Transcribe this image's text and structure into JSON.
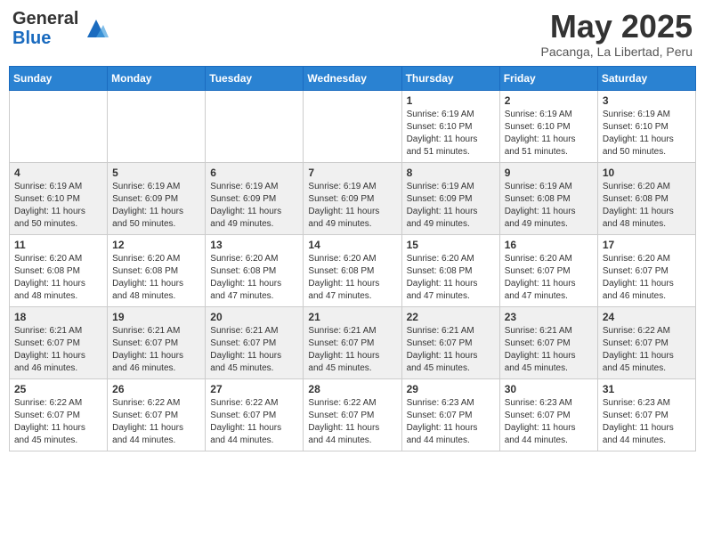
{
  "header": {
    "logo_general": "General",
    "logo_blue": "Blue",
    "month_title": "May 2025",
    "subtitle": "Pacanga, La Libertad, Peru"
  },
  "days_of_week": [
    "Sunday",
    "Monday",
    "Tuesday",
    "Wednesday",
    "Thursday",
    "Friday",
    "Saturday"
  ],
  "weeks": [
    [
      {
        "day": "",
        "info": ""
      },
      {
        "day": "",
        "info": ""
      },
      {
        "day": "",
        "info": ""
      },
      {
        "day": "",
        "info": ""
      },
      {
        "day": "1",
        "info": "Sunrise: 6:19 AM\nSunset: 6:10 PM\nDaylight: 11 hours and 51 minutes."
      },
      {
        "day": "2",
        "info": "Sunrise: 6:19 AM\nSunset: 6:10 PM\nDaylight: 11 hours and 51 minutes."
      },
      {
        "day": "3",
        "info": "Sunrise: 6:19 AM\nSunset: 6:10 PM\nDaylight: 11 hours and 50 minutes."
      }
    ],
    [
      {
        "day": "4",
        "info": "Sunrise: 6:19 AM\nSunset: 6:10 PM\nDaylight: 11 hours and 50 minutes."
      },
      {
        "day": "5",
        "info": "Sunrise: 6:19 AM\nSunset: 6:09 PM\nDaylight: 11 hours and 50 minutes."
      },
      {
        "day": "6",
        "info": "Sunrise: 6:19 AM\nSunset: 6:09 PM\nDaylight: 11 hours and 49 minutes."
      },
      {
        "day": "7",
        "info": "Sunrise: 6:19 AM\nSunset: 6:09 PM\nDaylight: 11 hours and 49 minutes."
      },
      {
        "day": "8",
        "info": "Sunrise: 6:19 AM\nSunset: 6:09 PM\nDaylight: 11 hours and 49 minutes."
      },
      {
        "day": "9",
        "info": "Sunrise: 6:19 AM\nSunset: 6:08 PM\nDaylight: 11 hours and 49 minutes."
      },
      {
        "day": "10",
        "info": "Sunrise: 6:20 AM\nSunset: 6:08 PM\nDaylight: 11 hours and 48 minutes."
      }
    ],
    [
      {
        "day": "11",
        "info": "Sunrise: 6:20 AM\nSunset: 6:08 PM\nDaylight: 11 hours and 48 minutes."
      },
      {
        "day": "12",
        "info": "Sunrise: 6:20 AM\nSunset: 6:08 PM\nDaylight: 11 hours and 48 minutes."
      },
      {
        "day": "13",
        "info": "Sunrise: 6:20 AM\nSunset: 6:08 PM\nDaylight: 11 hours and 47 minutes."
      },
      {
        "day": "14",
        "info": "Sunrise: 6:20 AM\nSunset: 6:08 PM\nDaylight: 11 hours and 47 minutes."
      },
      {
        "day": "15",
        "info": "Sunrise: 6:20 AM\nSunset: 6:08 PM\nDaylight: 11 hours and 47 minutes."
      },
      {
        "day": "16",
        "info": "Sunrise: 6:20 AM\nSunset: 6:07 PM\nDaylight: 11 hours and 47 minutes."
      },
      {
        "day": "17",
        "info": "Sunrise: 6:20 AM\nSunset: 6:07 PM\nDaylight: 11 hours and 46 minutes."
      }
    ],
    [
      {
        "day": "18",
        "info": "Sunrise: 6:21 AM\nSunset: 6:07 PM\nDaylight: 11 hours and 46 minutes."
      },
      {
        "day": "19",
        "info": "Sunrise: 6:21 AM\nSunset: 6:07 PM\nDaylight: 11 hours and 46 minutes."
      },
      {
        "day": "20",
        "info": "Sunrise: 6:21 AM\nSunset: 6:07 PM\nDaylight: 11 hours and 45 minutes."
      },
      {
        "day": "21",
        "info": "Sunrise: 6:21 AM\nSunset: 6:07 PM\nDaylight: 11 hours and 45 minutes."
      },
      {
        "day": "22",
        "info": "Sunrise: 6:21 AM\nSunset: 6:07 PM\nDaylight: 11 hours and 45 minutes."
      },
      {
        "day": "23",
        "info": "Sunrise: 6:21 AM\nSunset: 6:07 PM\nDaylight: 11 hours and 45 minutes."
      },
      {
        "day": "24",
        "info": "Sunrise: 6:22 AM\nSunset: 6:07 PM\nDaylight: 11 hours and 45 minutes."
      }
    ],
    [
      {
        "day": "25",
        "info": "Sunrise: 6:22 AM\nSunset: 6:07 PM\nDaylight: 11 hours and 45 minutes."
      },
      {
        "day": "26",
        "info": "Sunrise: 6:22 AM\nSunset: 6:07 PM\nDaylight: 11 hours and 44 minutes."
      },
      {
        "day": "27",
        "info": "Sunrise: 6:22 AM\nSunset: 6:07 PM\nDaylight: 11 hours and 44 minutes."
      },
      {
        "day": "28",
        "info": "Sunrise: 6:22 AM\nSunset: 6:07 PM\nDaylight: 11 hours and 44 minutes."
      },
      {
        "day": "29",
        "info": "Sunrise: 6:23 AM\nSunset: 6:07 PM\nDaylight: 11 hours and 44 minutes."
      },
      {
        "day": "30",
        "info": "Sunrise: 6:23 AM\nSunset: 6:07 PM\nDaylight: 11 hours and 44 minutes."
      },
      {
        "day": "31",
        "info": "Sunrise: 6:23 AM\nSunset: 6:07 PM\nDaylight: 11 hours and 44 minutes."
      }
    ]
  ]
}
